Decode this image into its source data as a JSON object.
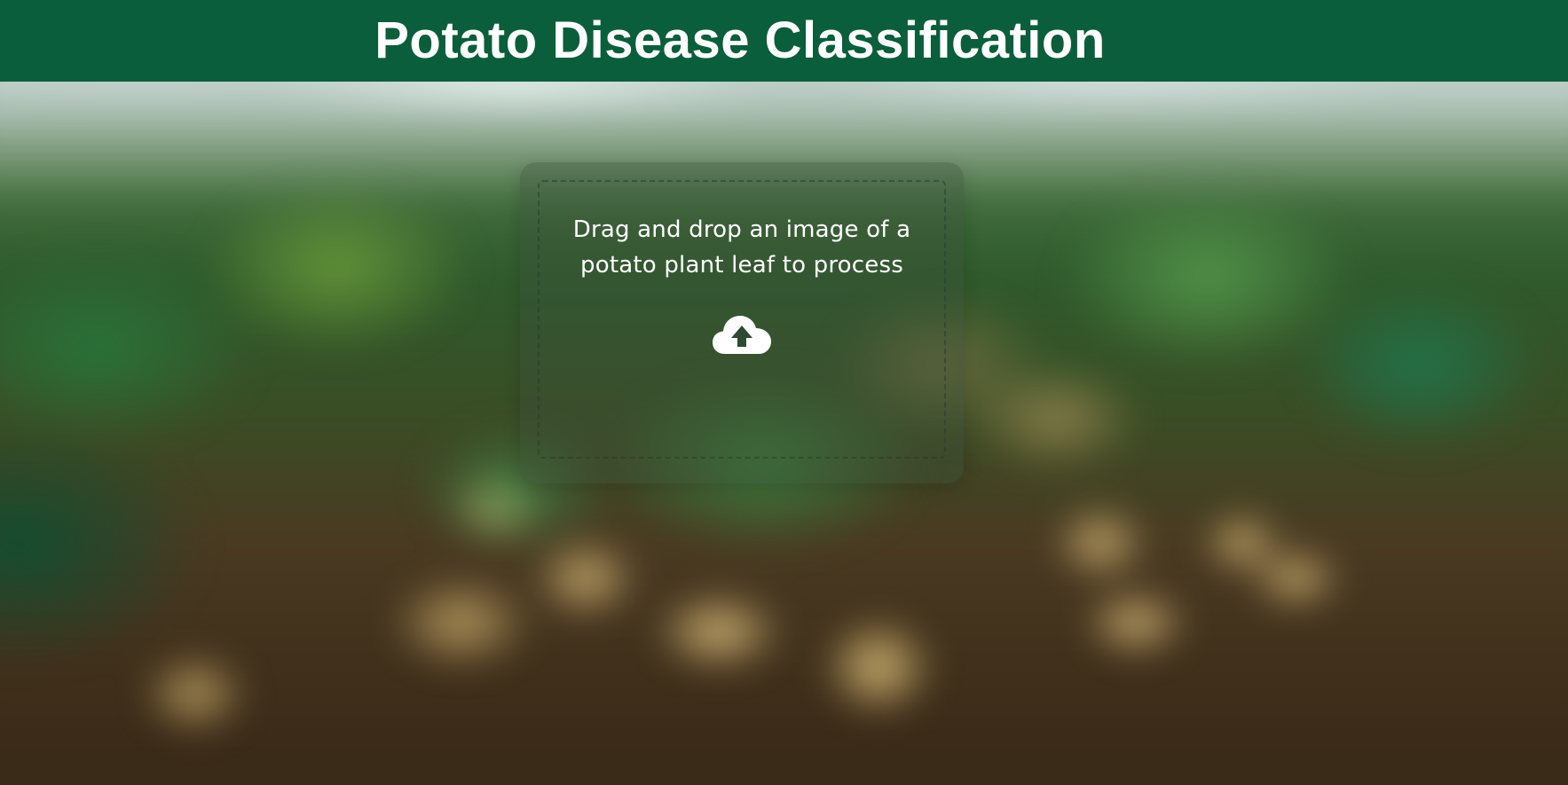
{
  "header": {
    "title": "Potato Disease Classification"
  },
  "upload": {
    "prompt_line1": "Drag and drop an image of a",
    "prompt_line2": "potato plant leaf to process",
    "icon": "cloud-upload-icon"
  },
  "colors": {
    "header_bg": "#0b5e3b",
    "text": "#ffffff"
  }
}
